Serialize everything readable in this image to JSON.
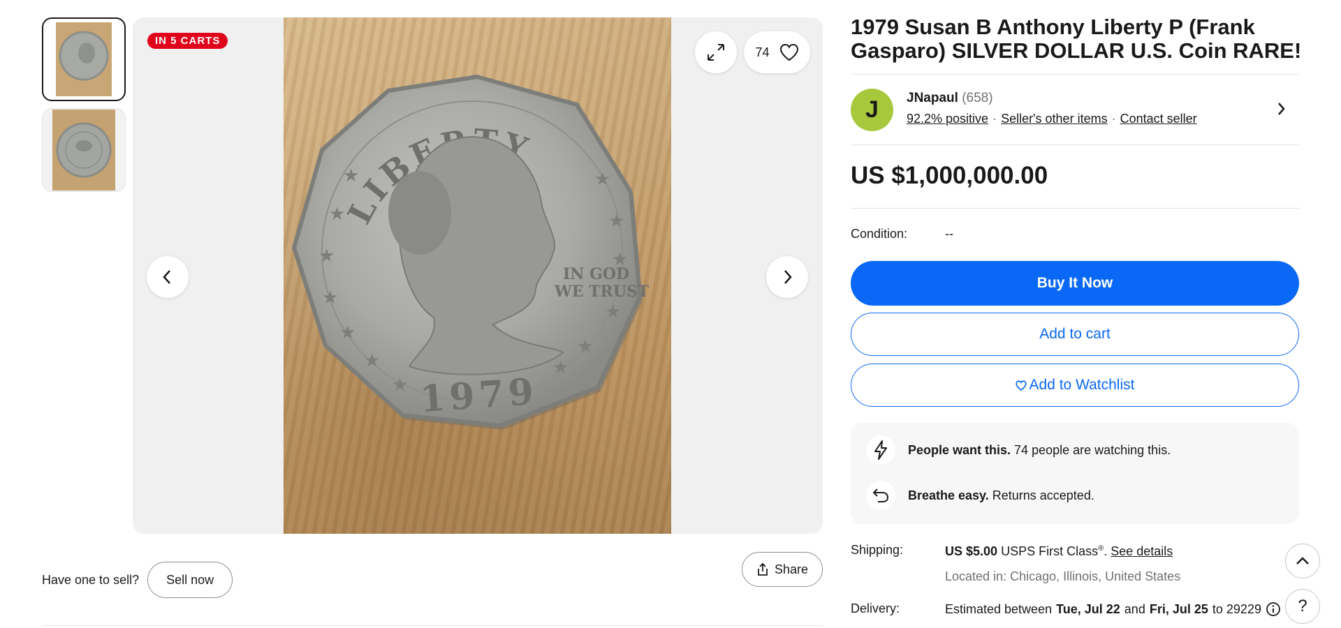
{
  "gallery": {
    "badge": "IN 5 CARTS",
    "watch_count": "74",
    "thumbnails": [
      "coin-front-thumbnail",
      "coin-back-thumbnail"
    ]
  },
  "sell": {
    "prompt": "Have one to sell?",
    "button": "Sell now"
  },
  "share_label": "Share",
  "listing": {
    "title": "1979 Susan B Anthony Liberty P (Frank Gasparo) SILVER DOLLAR U.S. Coin RARE!",
    "price": "US $1,000,000.00",
    "condition_label": "Condition:",
    "condition_value": "--"
  },
  "seller": {
    "initial": "J",
    "name": "JNapaul",
    "feedback_count": "(658)",
    "positive": "92.2% positive",
    "other_items": "Seller's other items",
    "contact": "Contact seller"
  },
  "actions": {
    "buy_now": "Buy It Now",
    "add_cart": "Add to cart",
    "watchlist": "Add to Watchlist"
  },
  "highlights": {
    "people_bold": "People want this.",
    "people_text": "74 people are watching this.",
    "returns_bold": "Breathe easy.",
    "returns_text": "Returns accepted."
  },
  "shipping": {
    "label": "Shipping:",
    "price": "US $5.00",
    "service": "USPS First Class",
    "reg": "®",
    "period": ".",
    "details_link": "See details",
    "location": "Located in: Chicago, Illinois, United States"
  },
  "delivery": {
    "label": "Delivery:",
    "prefix": "Estimated between",
    "date1": "Tue, Jul 22",
    "and": "and",
    "date2": "Fri, Jul 25",
    "to": "to 29229"
  },
  "coin": {
    "legend": "LIBERTY",
    "motto_line1": "IN GOD",
    "motto_line2": "WE TRUST",
    "year": "1979"
  },
  "colors": {
    "accent": "#0968f6",
    "badge": "#e0021a",
    "avatar": "#a8c83c"
  },
  "help_symbol": "?"
}
